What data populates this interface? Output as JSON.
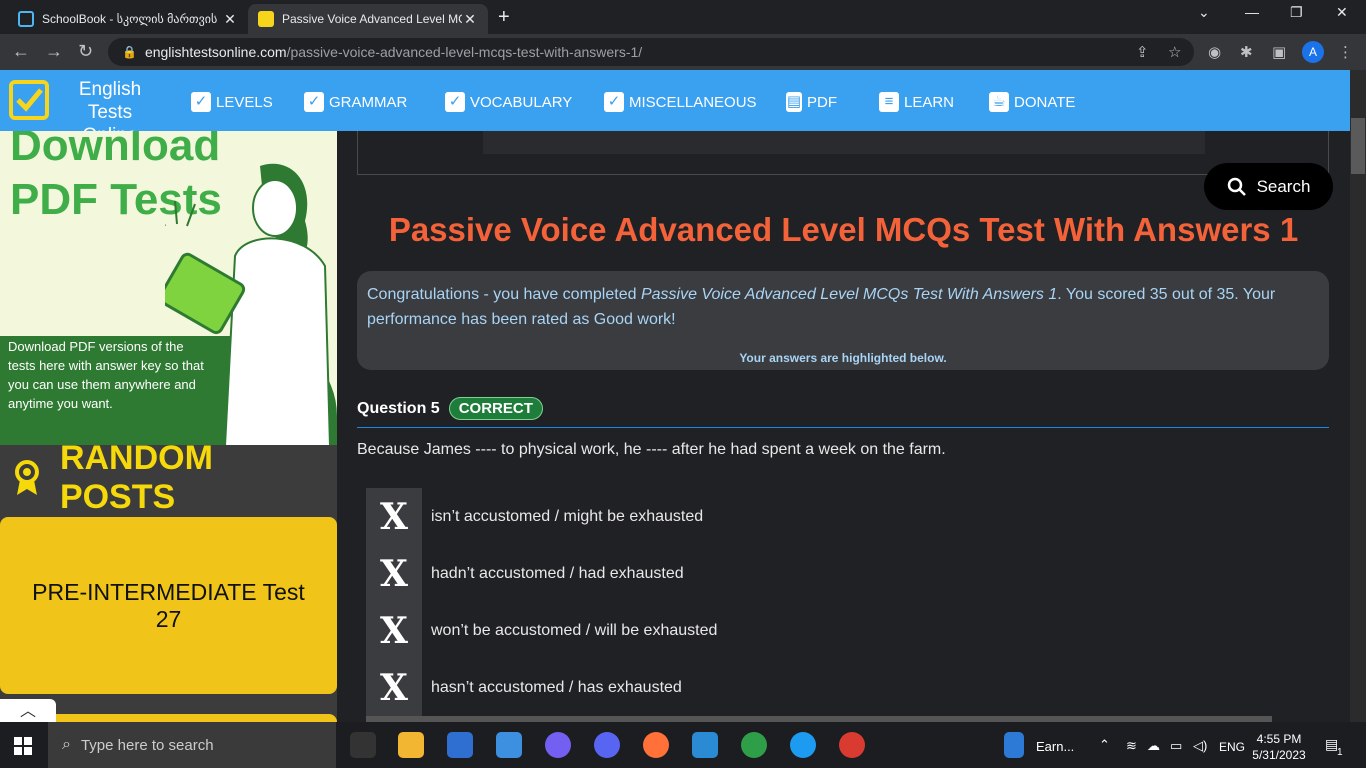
{
  "browser": {
    "tabs": [
      {
        "title": "SchoolBook - სკოლის მართვის"
      },
      {
        "title": "Passive Voice Advanced Level MCQs"
      }
    ],
    "url_domain": "englishtestsonline.com",
    "url_path": "/passive-voice-advanced-level-mcqs-test-with-answers-1/",
    "profile_initial": "A"
  },
  "site": {
    "logo_line1": "English Tests",
    "logo_line2": "Online",
    "nav": [
      {
        "label": "LEVELS",
        "icon": "checkbox-icon"
      },
      {
        "label": "GRAMMAR",
        "icon": "checkbox-icon"
      },
      {
        "label": "VOCABULARY",
        "icon": "checkbox-icon"
      },
      {
        "label": "MISCELLANEOUS",
        "icon": "checkbox-icon"
      },
      {
        "label": "PDF",
        "icon": "pdf-icon"
      },
      {
        "label": "LEARN",
        "icon": "book-icon"
      },
      {
        "label": "DONATE",
        "icon": "coffee-icon"
      }
    ]
  },
  "sidebar": {
    "promo_title_line1": "Download",
    "promo_title_line2": "PDF Tests",
    "promo_text": "Download PDF versions of the tests here with answer key so that you can use them anywhere and anytime you want.",
    "random_posts_title": "RANDOM POSTS",
    "card_title": "PRE-INTERMEDIATE Test 27",
    "scroll_up": "^"
  },
  "main": {
    "search_label": "Search",
    "page_title": "Passive Voice Advanced Level MCQs Test With Answers 1",
    "result_prefix": "Congratulations - you have completed ",
    "result_test_name": "Passive Voice Advanced Level MCQs Test With Answers 1",
    "result_suffix": ". You scored 35 out of 35. Your performance has been rated as Good work!",
    "result_note": "Your answers are highlighted below.",
    "question_label": "Question 5",
    "question_status": "CORRECT",
    "question_text": "Because James ---- to physical work, he ---- after he had spent a week on the farm.",
    "answers": [
      {
        "text": "isn’t accustomed / might be exhausted",
        "mark": "X"
      },
      {
        "text": "hadn’t accustomed / had exhausted",
        "mark": "X"
      },
      {
        "text": "won’t be accustomed / will be exhausted",
        "mark": "X"
      },
      {
        "text": "hasn’t accustomed / has exhausted",
        "mark": "X"
      }
    ]
  },
  "taskbar": {
    "search_placeholder": "Type here to search",
    "earn_label": "Earn...",
    "lang": "ENG",
    "time": "4:55 PM",
    "date": "5/31/2023",
    "notifications": "1"
  },
  "colors": {
    "site_nav_bg": "#3aa0f0",
    "title_orange": "#f4623a",
    "random_yellow": "#f5d90a",
    "card_yellow": "#f0c419",
    "correct_green": "#1e7d3a"
  }
}
